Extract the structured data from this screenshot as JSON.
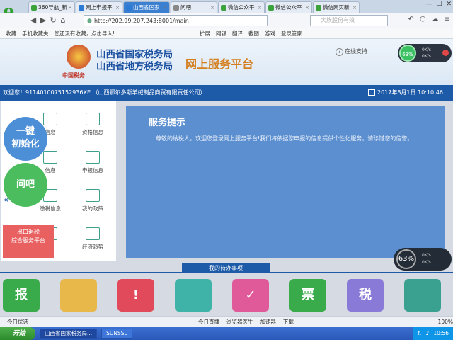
{
  "browser": {
    "tabs": [
      {
        "label": "360导航_新",
        "color": "#3ca23c"
      },
      {
        "label": "网上申报平",
        "color": "#2a7ad6"
      },
      {
        "label": "山西省国家",
        "color": "#2a7ad6",
        "active": true
      },
      {
        "label": "问吧",
        "color": "#888888"
      },
      {
        "label": "微信公众平",
        "color": "#3ca23c"
      },
      {
        "label": "微信公众平",
        "color": "#3ca23c"
      },
      {
        "label": "微信网页新",
        "color": "#3ca23c"
      }
    ],
    "url": "http://202.99.207.243:8001/main",
    "search_placeholder": "大族股份有效",
    "favorites": [
      "收藏",
      "手机收藏夹",
      "您还没有收藏，点击导入!",
      "扩展",
      "网银",
      "翻译",
      "截图",
      "游戏",
      "登录管家"
    ]
  },
  "header": {
    "emblem_caption": "中国税务",
    "title_line1": "山西省国家税务局",
    "title_line2": "山西省地方税务局",
    "title_platform": "网上服务平台",
    "help_label": "在线支持"
  },
  "speed_widget_top": {
    "percent": "63%",
    "up": "0K/s",
    "down": "0K/s"
  },
  "welcome": {
    "text": "欢迎您！91140100751529З6XE （山西鄂尔多斯羊绒制品商贸有限责任公司）",
    "date": "2017年8月1日 10:10:46"
  },
  "menu": {
    "items": [
      "信息",
      "资格信息",
      "信息",
      "申报信息",
      "缴税信息",
      "我的政策",
      "",
      "经济趋势"
    ]
  },
  "float_buttons": {
    "reset_line1": "一键",
    "reset_line2": "初始化",
    "ask": "问吧",
    "export_line1": "出口退税",
    "export_line2": "综合服务平台"
  },
  "notice": {
    "title": "服务提示",
    "text": "尊敬的纳税人，欢迎您登录网上服务平台!我们将依据您申报的信息提供个性化服务，请珍惜您的信誉。"
  },
  "speed_widget_bottom": {
    "percent": "63%",
    "up": "0K/s",
    "down": "0K/s"
  },
  "todo": {
    "title": "我的待办事项",
    "icons": [
      {
        "glyph": "报",
        "color": "#3aab4a"
      },
      {
        "glyph": "",
        "color": "#e8b84a"
      },
      {
        "glyph": "!",
        "color": "#e04a5a"
      },
      {
        "glyph": "",
        "color": "#3fb3a8"
      },
      {
        "glyph": "✓",
        "color": "#e05a9a"
      },
      {
        "glyph": "票",
        "color": "#3aab4a"
      },
      {
        "glyph": "税",
        "color": "#8a7ad8"
      },
      {
        "glyph": "",
        "color": "#3aa090"
      }
    ]
  },
  "statusbar": {
    "items": [
      "今日优选",
      "今日直播",
      "浏览器医生",
      "加速器",
      "下载",
      "100%"
    ]
  },
  "taskbar": {
    "start": "开始",
    "items": [
      "山西省国家税务局...",
      "SUNSSL"
    ],
    "time": "10:56"
  }
}
